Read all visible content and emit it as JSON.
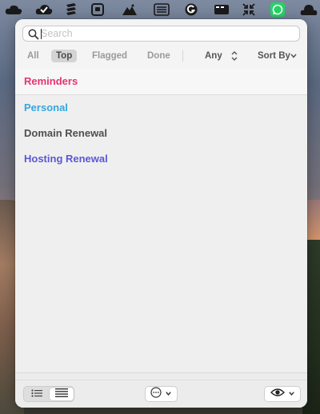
{
  "menubar": {
    "icons": [
      "cloud-icon",
      "check-circle-icon",
      "stack-icon",
      "tray-icon",
      "mountain-icon",
      "list-card-icon",
      "grammarly-icon",
      "video-icon",
      "collapse-arrows-icon",
      "whatsapp-icon",
      "cloud-app-icon"
    ]
  },
  "search": {
    "placeholder": "Search",
    "value": ""
  },
  "filters": {
    "tabs": [
      {
        "label": "All",
        "active": false
      },
      {
        "label": "Top",
        "active": true
      },
      {
        "label": "Flagged",
        "active": false
      },
      {
        "label": "Done",
        "active": false
      }
    ],
    "any_label": "Any",
    "sort_label": "Sort By"
  },
  "lists": [
    {
      "label": "Reminders",
      "color": "#e8336e"
    },
    {
      "label": "Personal",
      "color": "#35a7e0"
    },
    {
      "label": "Domain Renewal",
      "color": "#4f4f4f"
    },
    {
      "label": "Hosting Renewal",
      "color": "#5b57d6"
    }
  ],
  "footer": {
    "view_modes": [
      "list-view-icon",
      "compact-view-icon"
    ],
    "active_view": 1,
    "more_icon": "ellipsis-circle-icon",
    "eye_icon": "eye-icon"
  },
  "colors": {
    "accent_whatsapp": "#25d366"
  }
}
